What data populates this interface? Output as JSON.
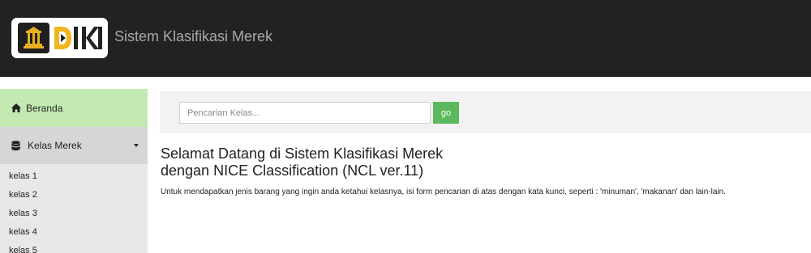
{
  "header": {
    "title": "Sistem Klasifikasi Merek",
    "background": "#222222",
    "logo_text": "DJKI"
  },
  "sidebar": {
    "home": {
      "label": "Beranda",
      "icon": "home-icon",
      "background": "#c3eab0"
    },
    "kelas_menu": {
      "label": "Kelas Merek",
      "icon": "database-icon",
      "expanded": true
    },
    "kelas_items": [
      {
        "label": "kelas 1"
      },
      {
        "label": "kelas 2"
      },
      {
        "label": "kelas 3"
      },
      {
        "label": "kelas 4"
      },
      {
        "label": "kelas 5"
      }
    ]
  },
  "search": {
    "placeholder": "Pencarian Kelas...",
    "value": "",
    "button_label": "go",
    "button_color": "#5cb85c"
  },
  "main": {
    "heading_line1": "Selamat Datang di Sistem Klasifikasi Merek",
    "heading_line2": "dengan NICE Classification (NCL ver.11)",
    "intro": "Untuk mendapatkan jenis barang yang ingin anda ketahui kelasnya, isi form pencarian di atas dengan kata kunci, seperti : 'minuman', 'makanan' dan lain-lain."
  }
}
